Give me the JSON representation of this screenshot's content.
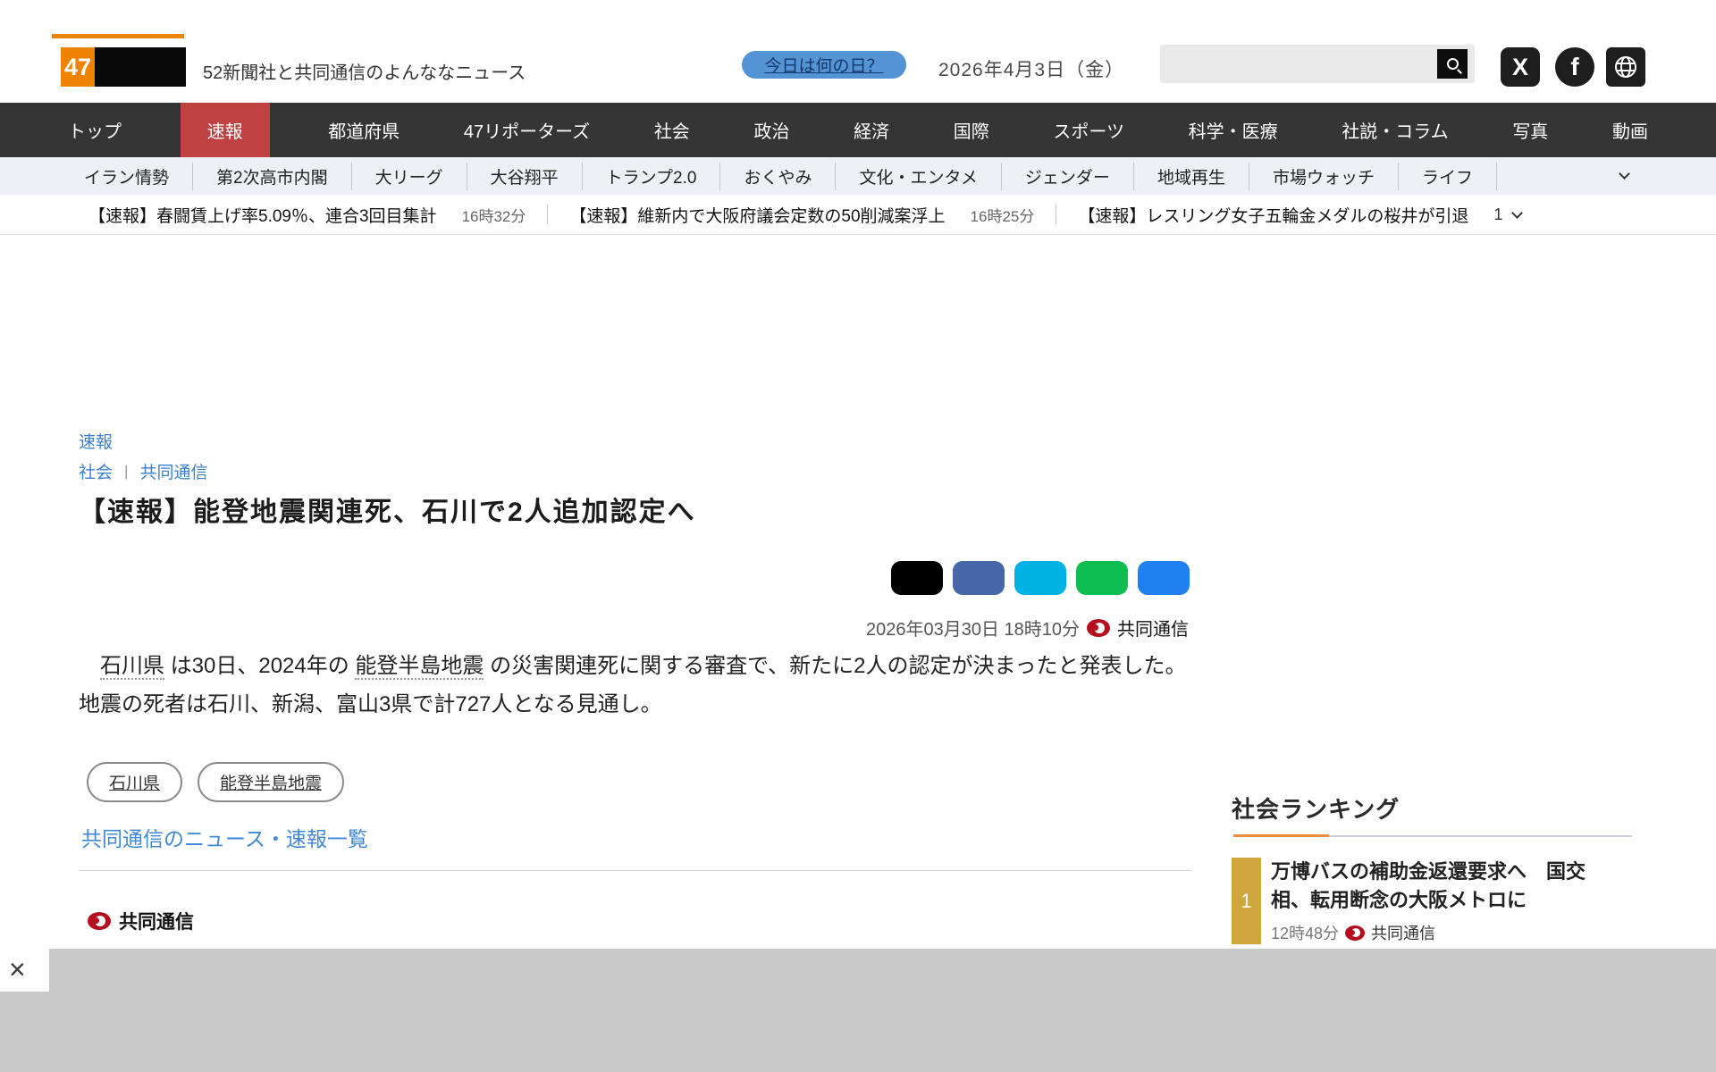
{
  "header": {
    "logo_number": "47",
    "tagline": "52新聞社と共同通信のよんななニュース",
    "today_button": "今日は何の日？",
    "date": "2026年4月3日（金）",
    "search": {
      "value": "",
      "placeholder": ""
    }
  },
  "nav": {
    "items": [
      "トップ",
      "速報",
      "都道府県",
      "47リポーターズ",
      "社会",
      "政治",
      "経済",
      "国際",
      "スポーツ",
      "科学・医療",
      "社説・コラム",
      "写真",
      "動画"
    ],
    "active_index": 1
  },
  "subnav": {
    "items": [
      "イラン情勢",
      "第2次高市内閣",
      "大リーグ",
      "大谷翔平",
      "トランプ2.0",
      "おくやみ",
      "文化・エンタメ",
      "ジェンダー",
      "地域再生",
      "市場ウォッチ",
      "ライフ"
    ]
  },
  "ticker": {
    "items": [
      {
        "title": "【速報】春闘賃上げ率5.09％、連合3回目集計",
        "time": "16時32分"
      },
      {
        "title": "【速報】維新内で大阪府議会定数の50削減案浮上",
        "time": "16時25分"
      },
      {
        "title": "【速報】レスリング女子五輪金メダルの桜井が引退",
        "time": ""
      }
    ],
    "count": "1"
  },
  "article": {
    "breadcrumb_top": "速報",
    "breadcrumb_category": "社会",
    "breadcrumb_divider": "|",
    "breadcrumb_source": "共同通信",
    "headline": "【速報】能登地震関連死、石川で2人追加認定へ",
    "datetime": "2026年03月30日 18時10分",
    "source": "共同通信",
    "body_segments": [
      {
        "type": "text",
        "text": "　"
      },
      {
        "type": "link",
        "text": "石川県"
      },
      {
        "type": "text",
        "text": " は30日、2024年の "
      },
      {
        "type": "link",
        "text": "能登半島地震"
      },
      {
        "type": "text",
        "text": " の災害関連死に関する審査で、新たに2人の認定が決まったと発表した。地震の死者は石川、新潟、富山3県で計727人となる見通し。"
      }
    ],
    "tags": [
      "石川県",
      "能登半島地震"
    ],
    "more_link": "共同通信のニュース・速報一覧",
    "footer_source": "共同通信"
  },
  "share_buttons": [
    {
      "name": "x",
      "color": "#000000"
    },
    {
      "name": "facebook",
      "color": "#4867aa"
    },
    {
      "name": "hatena",
      "color": "#00b2e3"
    },
    {
      "name": "line",
      "color": "#0fbe53"
    },
    {
      "name": "messenger",
      "color": "#2080f0"
    }
  ],
  "sidebar": {
    "title": "社会ランキング",
    "ranking": [
      {
        "rank": "1",
        "title": "万博バスの補助金返還要求へ　国交相、転用断念の大阪メトロに",
        "time": "12時48分",
        "source": "共同通信"
      }
    ]
  },
  "banner": {
    "close_label": "×"
  },
  "colors": {
    "brand_orange": "#ef8200",
    "nav_bg": "#353535",
    "nav_active_red": "#bf4141",
    "subnav_bg": "#edf1f6",
    "link_blue": "#3c80cd",
    "today_button_blue": "#5493d4",
    "rank_gold": "#d2a63f",
    "kyodo_red": "#b50d1e",
    "banner_gray": "#c9c9c9"
  }
}
